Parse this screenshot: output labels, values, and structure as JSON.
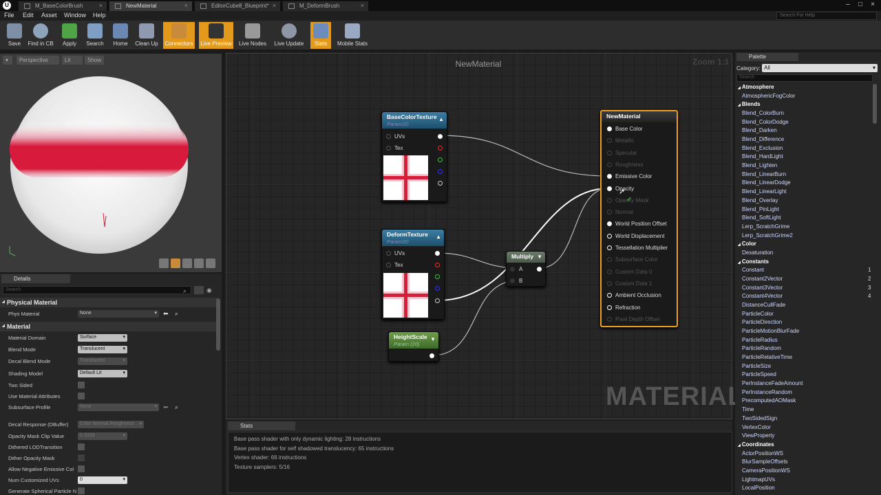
{
  "window": {
    "tabs": [
      {
        "label": "M_BaseColorBrush",
        "active": false
      },
      {
        "label": "NewMaterial",
        "active": true
      },
      {
        "label": "EditorCube8_Blueprint*",
        "active": false
      },
      {
        "label": "M_DeformBrush",
        "active": false
      }
    ],
    "search_placeholder": "Search For Help"
  },
  "menu": [
    "File",
    "Edit",
    "Asset",
    "Window",
    "Help"
  ],
  "toolbar": [
    {
      "label": "Save",
      "icon": "save-icon"
    },
    {
      "label": "Find in CB",
      "icon": "search-icon"
    },
    {
      "label": "Apply",
      "icon": "checkmark-icon"
    },
    {
      "label": "Search",
      "icon": "binoculars-icon"
    },
    {
      "label": "Home",
      "icon": "home-icon"
    },
    {
      "label": "Clean Up",
      "icon": "broom-icon"
    },
    {
      "label": "Connectors",
      "icon": "connectors-icon"
    },
    {
      "label": "Live Preview",
      "icon": "monitor-icon"
    },
    {
      "label": "Live Nodes",
      "icon": "nodes-icon"
    },
    {
      "label": "Live Update",
      "icon": "refresh-icon"
    },
    {
      "label": "Stats",
      "icon": "stats-icon"
    },
    {
      "label": "Mobile Stats",
      "icon": "mobile-stats-icon"
    }
  ],
  "viewport": {
    "perspective": "Perspective",
    "lit": "Lit",
    "show": "Show"
  },
  "details": {
    "tab": "Details",
    "search_placeholder": "Search",
    "physical_material": "Physical Material",
    "phys_material_label": "Phys Material",
    "phys_material_value": "None",
    "material": "Material",
    "rows": [
      {
        "label": "Material Domain",
        "value": "Surface"
      },
      {
        "label": "Blend Mode",
        "value": "Translucent"
      },
      {
        "label": "Decal Blend Mode",
        "value": "Translucent"
      },
      {
        "label": "Shading Model",
        "value": "Default Lit"
      }
    ],
    "two_sided": "Two Sided",
    "use_material_attributes": "Use Material Attributes",
    "subsurface_profile": "Subsurface Profile",
    "subsurface_value": "None",
    "decal_response": "Decal Response (DBuffer)",
    "decal_response_value": "Color Normal Roughness",
    "opacity_mask_clip": "Opacity Mask Clip Value",
    "opacity_mask_clip_value": "0.3333",
    "dithered_lod": "Dithered LODTransition",
    "dither_opacity": "Dither Opacity Mask",
    "allow_negative": "Allow Negative Emissive Col",
    "num_customized_uvs": "Num Customized UVs",
    "num_customized_uvs_value": "0",
    "generate_spherical": "Generate Spherical Particle N"
  },
  "graph": {
    "title": "NewMaterial",
    "zoom": "Zoom 1:1",
    "watermark": "MATERIAL",
    "nodes": {
      "base_color_texture": {
        "title": "BaseColorTexture",
        "sub": "Param2D",
        "uvs": "UVs",
        "tex": "Tex"
      },
      "deform_texture": {
        "title": "DeformTexture",
        "sub": "Param2D",
        "uvs": "UVs",
        "tex": "Tex"
      },
      "height_scale": {
        "title": "HeightScale",
        "sub": "Param (20)"
      },
      "multiply": {
        "title": "Multiply",
        "a": "A",
        "b": "B"
      },
      "new_material": {
        "title": "NewMaterial",
        "pins": [
          {
            "label": "Base Color",
            "active": true
          },
          {
            "label": "Metallic",
            "active": false
          },
          {
            "label": "Specular",
            "active": false
          },
          {
            "label": "Roughness",
            "active": false
          },
          {
            "label": "Emissive Color",
            "active": true
          },
          {
            "label": "Opacity",
            "active": true
          },
          {
            "label": "Opacity Mask",
            "active": false
          },
          {
            "label": "Normal",
            "active": false
          },
          {
            "label": "World Position Offset",
            "active": true
          },
          {
            "label": "World Displacement",
            "active": true
          },
          {
            "label": "Tessellation Multiplier",
            "active": true
          },
          {
            "label": "Subsurface Color",
            "active": false
          },
          {
            "label": "Custom Data 0",
            "active": false
          },
          {
            "label": "Custom Data 1",
            "active": false
          },
          {
            "label": "Ambient Occlusion",
            "active": true
          },
          {
            "label": "Refraction",
            "active": true
          },
          {
            "label": "Pixel Depth Offset",
            "active": false
          }
        ]
      }
    }
  },
  "stats": {
    "tab": "Stats",
    "lines": [
      "Base pass shader with only dynamic lighting: 28 instructions",
      "Base pass shader for self shadowed translucency: 65 instructions",
      "Vertex shader: 66 instructions",
      "Texture samplers: 5/16"
    ]
  },
  "palette": {
    "tab": "Palette",
    "category_label": "Category:",
    "category_value": "All",
    "search_placeholder": "Search",
    "entries": [
      {
        "t": "cat",
        "label": "Atmosphere"
      },
      {
        "t": "item",
        "label": "AtmosphericFogColor"
      },
      {
        "t": "cat",
        "label": "Blends"
      },
      {
        "t": "item",
        "label": "Blend_ColorBurn"
      },
      {
        "t": "item",
        "label": "Blend_ColorDodge"
      },
      {
        "t": "item",
        "label": "Blend_Darken"
      },
      {
        "t": "item",
        "label": "Blend_Difference"
      },
      {
        "t": "item",
        "label": "Blend_Exclusion"
      },
      {
        "t": "item",
        "label": "Blend_HardLight"
      },
      {
        "t": "item",
        "label": "Blend_Lighten"
      },
      {
        "t": "item",
        "label": "Blend_LinearBurn"
      },
      {
        "t": "item",
        "label": "Blend_LinearDodge"
      },
      {
        "t": "item",
        "label": "Blend_LinearLight"
      },
      {
        "t": "item",
        "label": "Blend_Overlay"
      },
      {
        "t": "item",
        "label": "Blend_PinLight"
      },
      {
        "t": "item",
        "label": "Blend_SoftLight"
      },
      {
        "t": "item",
        "label": "Lerp_ScratchGrime"
      },
      {
        "t": "item",
        "label": "Lerp_ScratchGrime2"
      },
      {
        "t": "cat",
        "label": "Color"
      },
      {
        "t": "item",
        "label": "Desaturation"
      },
      {
        "t": "cat",
        "label": "Constants"
      },
      {
        "t": "item",
        "label": "Constant",
        "num": "1"
      },
      {
        "t": "item",
        "label": "Constant2Vector",
        "num": "2"
      },
      {
        "t": "item",
        "label": "Constant3Vector",
        "num": "3"
      },
      {
        "t": "item",
        "label": "Constant4Vector",
        "num": "4"
      },
      {
        "t": "item",
        "label": "DistanceCullFade"
      },
      {
        "t": "item",
        "label": "ParticleColor"
      },
      {
        "t": "item",
        "label": "ParticleDirection"
      },
      {
        "t": "item",
        "label": "ParticleMotionBlurFade"
      },
      {
        "t": "item",
        "label": "ParticleRadius"
      },
      {
        "t": "item",
        "label": "ParticleRandom"
      },
      {
        "t": "item",
        "label": "ParticleRelativeTime"
      },
      {
        "t": "item",
        "label": "ParticleSize"
      },
      {
        "t": "item",
        "label": "ParticleSpeed"
      },
      {
        "t": "item",
        "label": "PerInstanceFadeAmount"
      },
      {
        "t": "item",
        "label": "PerInstanceRandom"
      },
      {
        "t": "item",
        "label": "PrecomputedAOMask"
      },
      {
        "t": "item",
        "label": "Time"
      },
      {
        "t": "item",
        "label": "TwoSidedSign"
      },
      {
        "t": "item",
        "label": "VertexColor"
      },
      {
        "t": "item",
        "label": "ViewProperty"
      },
      {
        "t": "cat",
        "label": "Coordinates"
      },
      {
        "t": "item",
        "label": "ActorPositionWS"
      },
      {
        "t": "item",
        "label": "BlurSampleOffsets"
      },
      {
        "t": "item",
        "label": "CameraPositionWS"
      },
      {
        "t": "item",
        "label": "LightmapUVs"
      },
      {
        "t": "item",
        "label": "LocalPosition"
      }
    ]
  }
}
